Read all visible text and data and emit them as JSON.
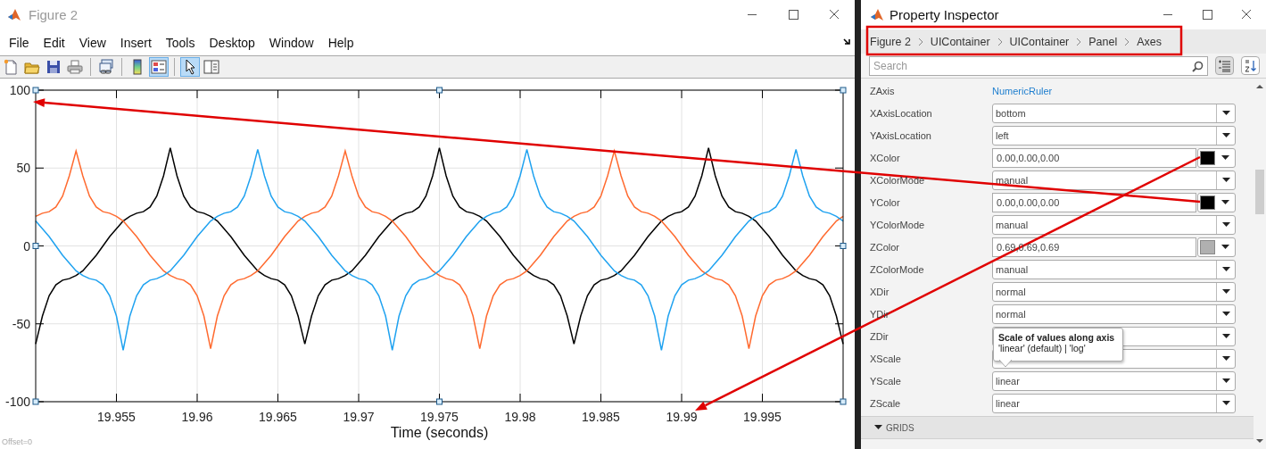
{
  "figure_window": {
    "title": "Figure 2",
    "menu": [
      "File",
      "Edit",
      "View",
      "Insert",
      "Tools",
      "Desktop",
      "Window",
      "Help"
    ],
    "toolbar": [
      {
        "kind": "new",
        "pressed": false
      },
      {
        "kind": "open",
        "pressed": false
      },
      {
        "kind": "save",
        "pressed": false
      },
      {
        "kind": "print",
        "pressed": false
      },
      {
        "kind": "separator"
      },
      {
        "kind": "link",
        "pressed": false
      },
      {
        "kind": "separator"
      },
      {
        "kind": "colorbar",
        "pressed": false
      },
      {
        "kind": "legend",
        "pressed": true
      },
      {
        "kind": "separator"
      },
      {
        "kind": "pointer",
        "pressed": true
      },
      {
        "kind": "panel",
        "pressed": false
      }
    ],
    "axes": {
      "offset_label": "Offset=0",
      "chart_data": {
        "type": "line",
        "grid": true,
        "xlabel": "Time (seconds)",
        "xlim": [
          19.95,
          20.0
        ],
        "ylim": [
          -100,
          100
        ],
        "xticks": [
          19.955,
          19.96,
          19.965,
          19.97,
          19.975,
          19.98,
          19.985,
          19.99,
          19.995
        ],
        "yticks": [
          -100,
          -50,
          0,
          50,
          100
        ],
        "x": [
          19.95,
          19.950417,
          19.950833,
          19.95125,
          19.951667,
          19.952083,
          19.9525,
          19.952917,
          19.953333,
          19.95375,
          19.954167,
          19.954583,
          19.955,
          19.955417,
          19.955833,
          19.95625,
          19.956667,
          19.957083,
          19.9575,
          19.957917,
          19.958333,
          19.95875,
          19.959167,
          19.959583,
          19.96,
          19.960417,
          19.960833,
          19.96125,
          19.961667,
          19.962083,
          19.9625,
          19.962917,
          19.963333,
          19.96375,
          19.964167,
          19.964583,
          19.965,
          19.965417,
          19.965833,
          19.96625,
          19.966667,
          19.967083,
          19.9675,
          19.967917,
          19.968333,
          19.96875,
          19.969167,
          19.969583,
          19.97,
          19.970417,
          19.970833,
          19.97125,
          19.971667,
          19.972083,
          19.9725,
          19.972917,
          19.973333,
          19.97375,
          19.974167,
          19.974583,
          19.975,
          19.975417,
          19.975833,
          19.97625,
          19.976667,
          19.977083,
          19.9775,
          19.977917,
          19.978333,
          19.97875,
          19.979167,
          19.979583,
          19.98,
          19.980417,
          19.980833,
          19.98125,
          19.981667,
          19.982083,
          19.9825,
          19.982917,
          19.983333,
          19.98375,
          19.984167,
          19.984583,
          19.985,
          19.985417,
          19.985833,
          19.98625,
          19.986667,
          19.987083,
          19.9875,
          19.987917,
          19.988333,
          19.98875,
          19.989167,
          19.989583,
          19.99,
          19.990417,
          19.990833,
          19.99125,
          19.991667,
          19.992083,
          19.9925,
          19.992917,
          19.993333,
          19.99375,
          19.994167,
          19.994583,
          19.995,
          19.995417,
          19.995833,
          19.99625,
          19.996667,
          19.997083,
          19.9975,
          19.997917,
          19.998333,
          19.99875,
          19.999167,
          19.999583,
          20.0
        ],
        "series": [
          {
            "color": "#000000",
            "values": [
              -63,
              -45,
              -32,
              -25,
              -22,
              -21,
              -19,
              -16,
              -11,
              -6,
              0,
              6,
              11,
              16,
              19,
              21,
              22,
              25,
              32,
              45,
              63,
              45,
              32,
              25,
              22,
              21,
              19,
              16,
              11,
              6,
              0,
              -6,
              -11,
              -16,
              -19,
              -21,
              -22,
              -25,
              -32,
              -45,
              -63,
              -45,
              -32,
              -25,
              -22,
              -21,
              -19,
              -16,
              -11,
              -6,
              0,
              6,
              11,
              16,
              19,
              21,
              22,
              25,
              32,
              45,
              63,
              45,
              32,
              25,
              22,
              21,
              19,
              16,
              11,
              6,
              0,
              -6,
              -11,
              -16,
              -19,
              -21,
              -22,
              -25,
              -32,
              -45,
              -63,
              -45,
              -32,
              -25,
              -22,
              -21,
              -19,
              -16,
              -11,
              -6,
              0,
              6,
              11,
              16,
              19,
              21,
              22,
              25,
              32,
              45,
              63,
              45,
              32,
              25,
              22,
              21,
              19,
              16,
              11,
              6,
              0,
              -6,
              -11,
              -16,
              -19,
              -21,
              -22,
              -25,
              -32,
              -45,
              -63
            ]
          },
          {
            "color": "#ff6a2f",
            "values": [
              19,
              21,
              22,
              25,
              32,
              45,
              61,
              45,
              32,
              25,
              22,
              21,
              19,
              16,
              11,
              6,
              0,
              -6,
              -11,
              -16,
              -19,
              -21,
              -22,
              -25,
              -32,
              -45,
              -66,
              -45,
              -32,
              -25,
              -22,
              -21,
              -19,
              -16,
              -11,
              -6,
              0,
              6,
              11,
              16,
              19,
              21,
              22,
              25,
              32,
              45,
              61,
              45,
              32,
              25,
              22,
              21,
              19,
              16,
              11,
              6,
              0,
              -6,
              -11,
              -16,
              -19,
              -21,
              -22,
              -25,
              -32,
              -45,
              -66,
              -45,
              -32,
              -25,
              -22,
              -21,
              -19,
              -16,
              -11,
              -6,
              0,
              6,
              11,
              16,
              19,
              21,
              22,
              25,
              32,
              45,
              61,
              45,
              32,
              25,
              22,
              21,
              19,
              16,
              11,
              6,
              0,
              -6,
              -11,
              -16,
              -19,
              -21,
              -22,
              -25,
              -32,
              -45,
              -66,
              -45,
              -32,
              -25,
              -22,
              -21,
              -19,
              -16,
              -11,
              -6,
              0,
              6,
              11,
              16,
              19
            ]
          },
          {
            "color": "#1fa2f0",
            "values": [
              16,
              11,
              6,
              0,
              -6,
              -11,
              -16,
              -19,
              -21,
              -22,
              -25,
              -32,
              -45,
              -67,
              -45,
              -32,
              -25,
              -22,
              -21,
              -19,
              -16,
              -11,
              -6,
              0,
              6,
              11,
              16,
              19,
              21,
              22,
              25,
              32,
              45,
              62,
              45,
              32,
              25,
              22,
              21,
              19,
              16,
              11,
              6,
              0,
              -6,
              -11,
              -16,
              -19,
              -21,
              -22,
              -25,
              -32,
              -45,
              -67,
              -45,
              -32,
              -25,
              -22,
              -21,
              -19,
              -16,
              -11,
              -6,
              0,
              6,
              11,
              16,
              19,
              21,
              22,
              25,
              32,
              45,
              62,
              45,
              32,
              25,
              22,
              21,
              19,
              16,
              11,
              6,
              0,
              -6,
              -11,
              -16,
              -19,
              -21,
              -22,
              -25,
              -32,
              -45,
              -67,
              -45,
              -32,
              -25,
              -22,
              -21,
              -19,
              -16,
              -11,
              -6,
              0,
              6,
              11,
              16,
              19,
              21,
              22,
              25,
              32,
              45,
              62,
              45,
              32,
              25,
              22,
              21,
              19,
              16
            ]
          }
        ]
      }
    }
  },
  "property_inspector": {
    "title": "Property Inspector",
    "breadcrumb": [
      "Figure 2",
      "UIContainer",
      "UIContainer",
      "Panel",
      "Axes"
    ],
    "search": {
      "placeholder": "Search"
    },
    "view_buttons": [
      {
        "kind": "categorized",
        "selected": true
      },
      {
        "kind": "alphabetical",
        "selected": false
      }
    ],
    "properties": [
      {
        "name": "ZAxis",
        "kind": "link",
        "value": "NumericRuler"
      },
      {
        "name": "XAxisLocation",
        "kind": "dropdown",
        "value": "bottom"
      },
      {
        "name": "YAxisLocation",
        "kind": "dropdown",
        "value": "left"
      },
      {
        "name": "XColor",
        "kind": "color",
        "value": "0.00,0.00,0.00",
        "color": "#000000"
      },
      {
        "name": "XColorMode",
        "kind": "dropdown",
        "value": "manual"
      },
      {
        "name": "YColor",
        "kind": "color",
        "value": "0.00,0.00,0.00",
        "color": "#000000"
      },
      {
        "name": "YColorMode",
        "kind": "dropdown",
        "value": "manual"
      },
      {
        "name": "ZColor",
        "kind": "color",
        "value": "0.69,0.69,0.69",
        "color": "#b0b0b0"
      },
      {
        "name": "ZColorMode",
        "kind": "dropdown",
        "value": "manual"
      },
      {
        "name": "XDir",
        "kind": "dropdown",
        "value": "normal"
      },
      {
        "name": "YDir",
        "kind": "dropdown",
        "value": "normal"
      },
      {
        "name": "ZDir",
        "kind": "dropdown"
      },
      {
        "name": "XScale",
        "kind": "dropdown"
      },
      {
        "name": "YScale",
        "kind": "dropdown",
        "value": "linear"
      },
      {
        "name": "ZScale",
        "kind": "dropdown",
        "value": "linear"
      }
    ],
    "tooltip": {
      "title": "Scale of values along axis",
      "text": "'linear' (default) | 'log'"
    },
    "section": {
      "label": "GRIDS",
      "expanded": true
    }
  }
}
